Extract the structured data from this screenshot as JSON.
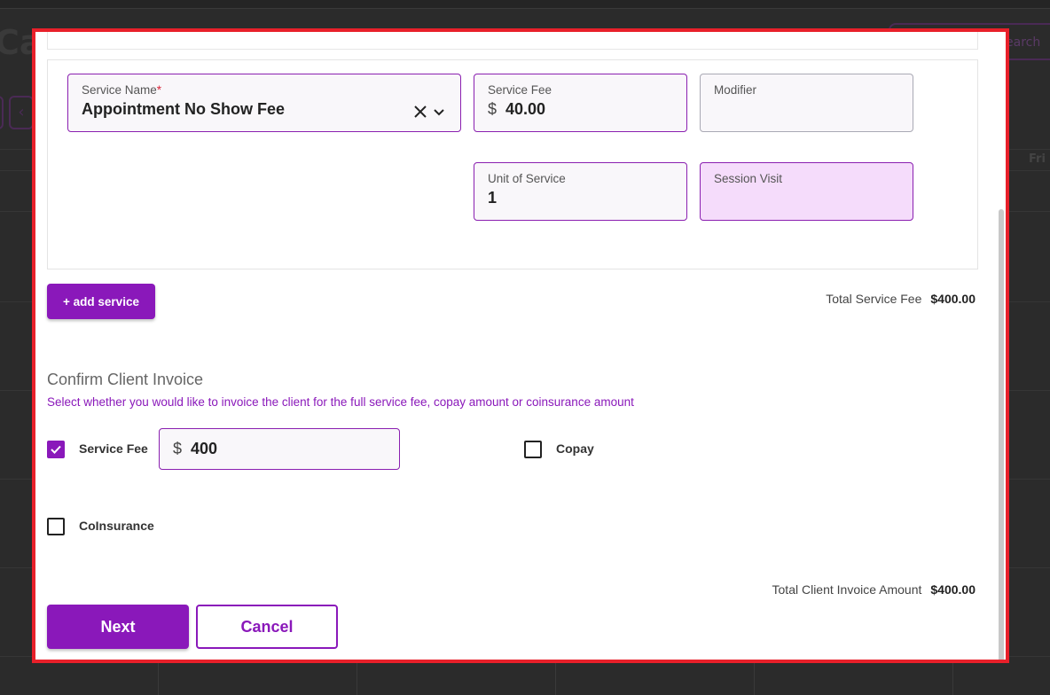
{
  "background": {
    "title_fragment": "Cal",
    "search_fragment": "earch",
    "nav_prev": "‹",
    "day_label": "Fri"
  },
  "service": {
    "name_label": "Service Name",
    "required_mark": "*",
    "name_value": "Appointment No Show Fee",
    "fee_label": "Service Fee",
    "currency": "$",
    "fee_value": "40.00",
    "modifier_label": "Modifier",
    "modifier_value": "",
    "unit_label": "Unit of Service",
    "unit_value": "1",
    "session_label": "Session Visit",
    "session_value": ""
  },
  "add_service_label": "+ add service",
  "total_service_fee": {
    "label": "Total Service Fee",
    "value": "$400.00"
  },
  "invoice": {
    "title": "Confirm Client Invoice",
    "subtitle": "Select whether you would like to invoice the client for the full service fee, copay amount or coinsurance amount",
    "service_fee_label": "Service Fee",
    "service_fee_checked": true,
    "currency": "$",
    "service_fee_amount": "400",
    "copay_label": "Copay",
    "copay_checked": false,
    "coinsurance_label": "CoInsurance",
    "coinsurance_checked": false
  },
  "total_invoice": {
    "label": "Total Client Invoice Amount",
    "value": "$400.00"
  },
  "buttons": {
    "next": "Next",
    "cancel": "Cancel"
  },
  "colors": {
    "accent": "#8a18ba",
    "highlight_border": "#e8202a",
    "session_bg": "#f5dcfb"
  }
}
